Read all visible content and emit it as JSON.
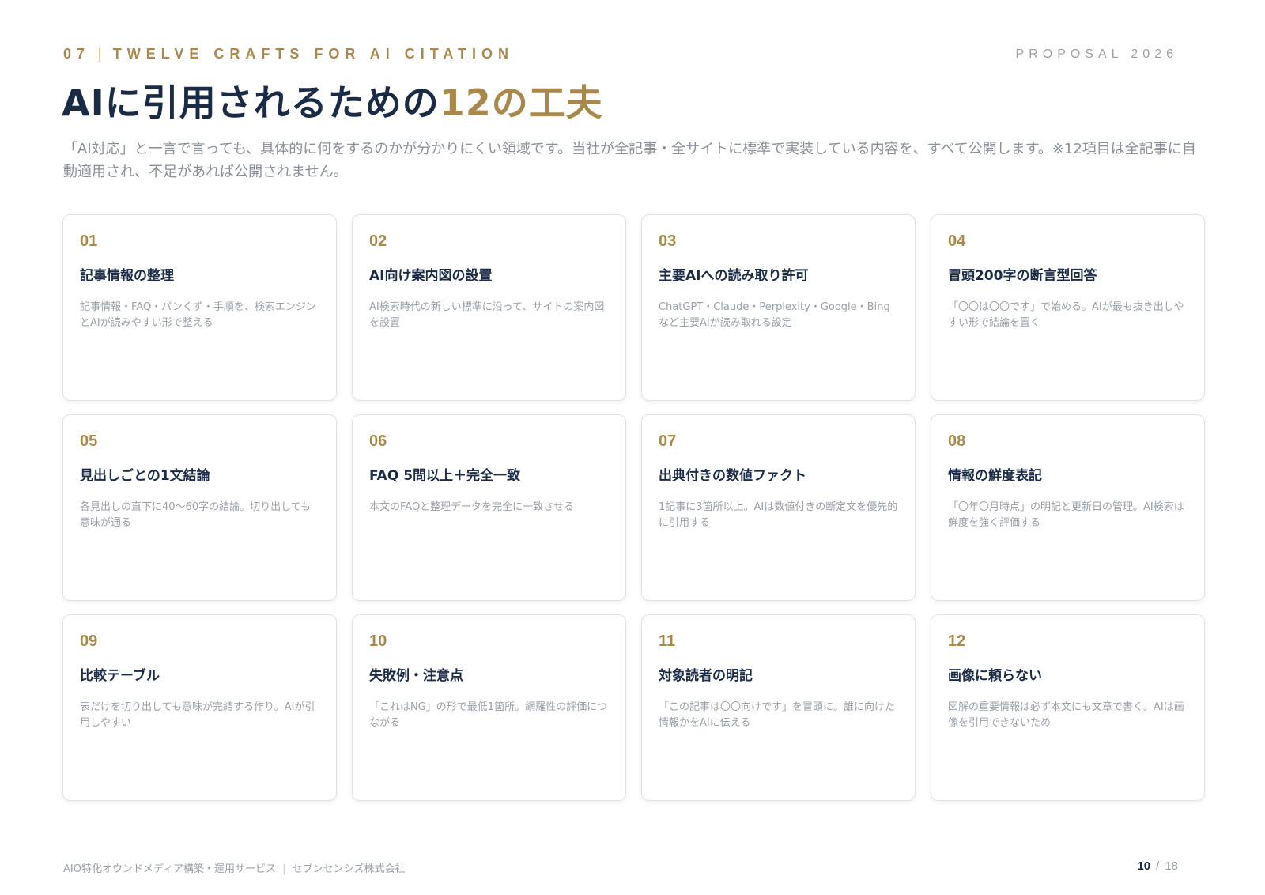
{
  "header": {
    "section_number": "07",
    "section_separator": "|",
    "section_title": "TWELVE CRAFTS FOR AI CITATION",
    "proposal": "PROPOSAL 2026"
  },
  "title": {
    "main": "AIに引用されるための",
    "accent": "12の工夫"
  },
  "lead": "「AI対応」と一言で言っても、具体的に何をするのかが分かりにくい領域です。当社が全記事・全サイトに標準で実装している内容を、すべて公開します。※12項目は全記事に自動適用され、不足があれば公開されません。",
  "cards": [
    {
      "num": "01",
      "title": "記事情報の整理",
      "desc": "記事情報・FAQ・パンくず・手順を、検索エンジンとAIが読みやすい形で整える"
    },
    {
      "num": "02",
      "title": "AI向け案内図の設置",
      "desc": "AI検索時代の新しい標準に沿って、サイトの案内図を設置"
    },
    {
      "num": "03",
      "title": "主要AIへの読み取り許可",
      "desc": "ChatGPT・Claude・Perplexity・Google・Bingなど主要AIが読み取れる設定"
    },
    {
      "num": "04",
      "title": "冒頭200字の断言型回答",
      "desc": "「〇〇は〇〇です」で始める。AIが最も抜き出しやすい形で結論を置く"
    },
    {
      "num": "05",
      "title": "見出しごとの1文結論",
      "desc": "各見出しの直下に40〜60字の結論。切り出しても意味が通る"
    },
    {
      "num": "06",
      "title": "FAQ 5問以上＋完全一致",
      "desc": "本文のFAQと整理データを完全に一致させる"
    },
    {
      "num": "07",
      "title": "出典付きの数値ファクト",
      "desc": "1記事に3箇所以上。AIは数値付きの断定文を優先的に引用する"
    },
    {
      "num": "08",
      "title": "情報の鮮度表記",
      "desc": "「〇年〇月時点」の明記と更新日の管理。AI検索は鮮度を強く評価する"
    },
    {
      "num": "09",
      "title": "比較テーブル",
      "desc": "表だけを切り出しても意味が完結する作り。AIが引用しやすい"
    },
    {
      "num": "10",
      "title": "失敗例・注意点",
      "desc": "「これはNG」の形で最低1箇所。網羅性の評価につながる"
    },
    {
      "num": "11",
      "title": "対象読者の明記",
      "desc": "「この記事は〇〇向けです」を冒頭に。誰に向けた情報かをAIに伝える"
    },
    {
      "num": "12",
      "title": "画像に頼らない",
      "desc": "図解の重要情報は必ず本文にも文章で書く。AIは画像を引用できないため"
    }
  ],
  "footer": {
    "service": "AIO特化オウンドメディア構築・運用サービス",
    "separator": "|",
    "company": "セブンセンシズ株式会社",
    "page_current": "10",
    "page_slash": "/",
    "page_total": "18"
  },
  "colors": {
    "accent": "#a8884b",
    "navy": "#1c2b45",
    "muted": "#9aa0a8",
    "card_border": "#dfe3e9"
  }
}
